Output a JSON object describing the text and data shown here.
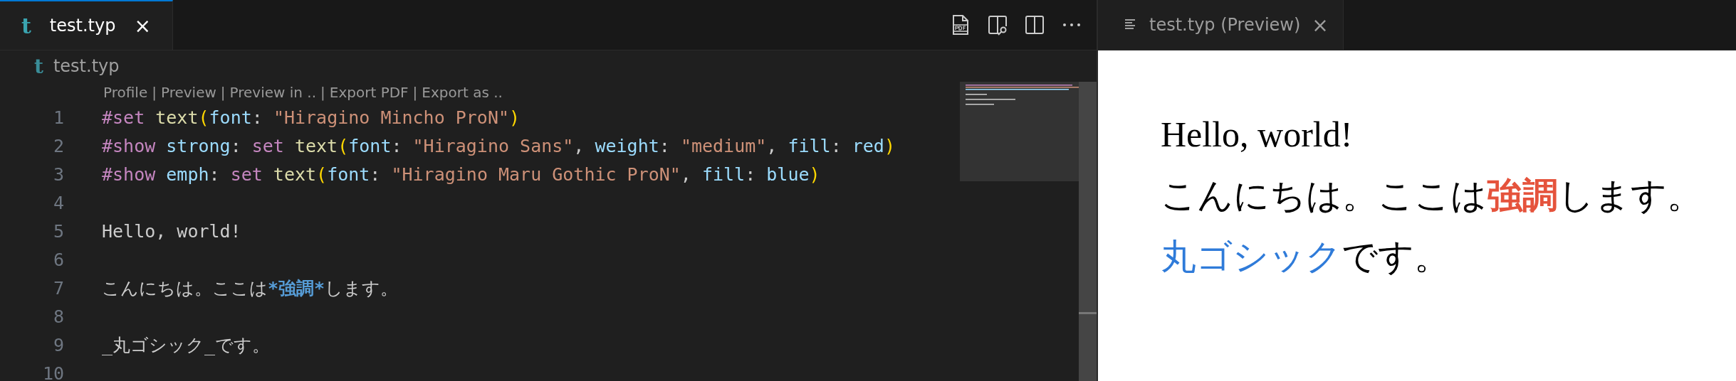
{
  "editor": {
    "tab": {
      "icon_glyph": "t",
      "label": "test.typ",
      "close": "×",
      "selected": true
    },
    "breadcrumb": {
      "icon_glyph": "t",
      "label": "test.typ"
    },
    "codelens": {
      "separator": "|",
      "items": [
        "Profile",
        "Preview",
        "Preview in ..",
        "Export PDF",
        "Export as .."
      ]
    },
    "lines": [
      {
        "number": "1",
        "tokens": [
          {
            "kind": "keyword",
            "text": "#set "
          },
          {
            "kind": "function",
            "text": "text"
          },
          {
            "kind": "paren",
            "text": "("
          },
          {
            "kind": "param",
            "text": "font"
          },
          {
            "kind": "plain",
            "text": ": "
          },
          {
            "kind": "string",
            "text": "\"Hiragino Mincho ProN\""
          },
          {
            "kind": "paren",
            "text": ")"
          }
        ]
      },
      {
        "number": "2",
        "tokens": [
          {
            "kind": "keyword",
            "text": "#show "
          },
          {
            "kind": "param",
            "text": "strong"
          },
          {
            "kind": "plain",
            "text": ": "
          },
          {
            "kind": "keyword",
            "text": "set "
          },
          {
            "kind": "function",
            "text": "text"
          },
          {
            "kind": "paren",
            "text": "("
          },
          {
            "kind": "param",
            "text": "font"
          },
          {
            "kind": "plain",
            "text": ": "
          },
          {
            "kind": "string",
            "text": "\"Hiragino Sans\""
          },
          {
            "kind": "plain",
            "text": ", "
          },
          {
            "kind": "param",
            "text": "weight"
          },
          {
            "kind": "plain",
            "text": ": "
          },
          {
            "kind": "string",
            "text": "\"medium\""
          },
          {
            "kind": "plain",
            "text": ", "
          },
          {
            "kind": "param",
            "text": "fill"
          },
          {
            "kind": "plain",
            "text": ": "
          },
          {
            "kind": "param",
            "text": "red"
          },
          {
            "kind": "paren",
            "text": ")"
          }
        ]
      },
      {
        "number": "3",
        "tokens": [
          {
            "kind": "keyword",
            "text": "#show "
          },
          {
            "kind": "param",
            "text": "emph"
          },
          {
            "kind": "plain",
            "text": ": "
          },
          {
            "kind": "keyword",
            "text": "set "
          },
          {
            "kind": "function",
            "text": "text"
          },
          {
            "kind": "paren",
            "text": "("
          },
          {
            "kind": "param",
            "text": "font"
          },
          {
            "kind": "plain",
            "text": ": "
          },
          {
            "kind": "string",
            "text": "\"Hiragino Maru Gothic ProN\""
          },
          {
            "kind": "plain",
            "text": ", "
          },
          {
            "kind": "param",
            "text": "fill"
          },
          {
            "kind": "plain",
            "text": ": "
          },
          {
            "kind": "param",
            "text": "blue"
          },
          {
            "kind": "paren",
            "text": ")"
          }
        ]
      },
      {
        "number": "4"
      },
      {
        "number": "5",
        "tokens": [
          {
            "kind": "plain",
            "text": "Hello, world!"
          }
        ]
      },
      {
        "number": "6"
      },
      {
        "number": "7",
        "tokens": [
          {
            "kind": "plain",
            "text": "こんにちは。ここは"
          },
          {
            "kind": "strong",
            "text": "*強調*"
          },
          {
            "kind": "plain",
            "text": "します。"
          }
        ]
      },
      {
        "number": "8"
      },
      {
        "number": "9",
        "tokens": [
          {
            "kind": "plain",
            "text": "_丸ゴシック_です。"
          }
        ]
      },
      {
        "number": "10"
      }
    ]
  },
  "preview": {
    "tab": {
      "label": "test.typ (Preview)",
      "close": "×",
      "selected": false
    },
    "paragraphs": [
      [
        {
          "kind": "normal",
          "text": "Hello, world!"
        }
      ],
      [
        {
          "kind": "normal",
          "text": "こんにちは。ここは"
        },
        {
          "kind": "strong",
          "text": "強調"
        },
        {
          "kind": "normal",
          "text": "します。"
        }
      ],
      [
        {
          "kind": "emph",
          "text": "丸ゴシック"
        },
        {
          "kind": "normal",
          "text": "です。"
        }
      ]
    ]
  }
}
